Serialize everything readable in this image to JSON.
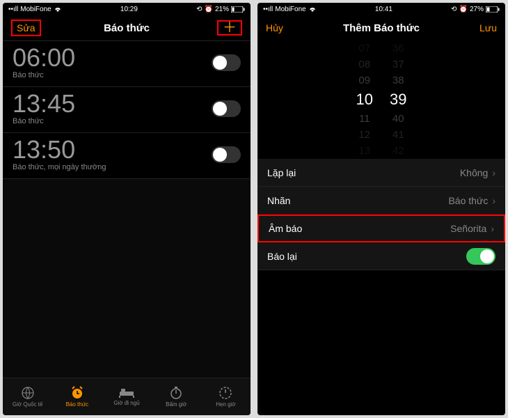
{
  "left": {
    "status": {
      "carrier": "MobiFone",
      "wifi": true,
      "time": "10:29",
      "alarm": true,
      "battery": "21%"
    },
    "nav": {
      "left": "Sửa",
      "title": "Báo thức",
      "right": "＋"
    },
    "alarms": [
      {
        "time": "06:00",
        "label": "Báo thức",
        "on": false
      },
      {
        "time": "13:45",
        "label": "Báo thức",
        "on": false
      },
      {
        "time": "13:50",
        "label": "Báo thức, mọi ngày thường",
        "on": false
      }
    ],
    "tabs": [
      {
        "label": "Giờ Quốc tế",
        "active": false
      },
      {
        "label": "Báo thức",
        "active": true
      },
      {
        "label": "Giờ đi ngủ",
        "active": false
      },
      {
        "label": "Bấm giờ",
        "active": false
      },
      {
        "label": "Hẹn giờ",
        "active": false
      }
    ]
  },
  "right": {
    "status": {
      "carrier": "MobiFone",
      "wifi": true,
      "time": "10:41",
      "alarm": true,
      "battery": "27%"
    },
    "nav": {
      "left": "Hủy",
      "title": "Thêm Báo thức",
      "right": "Lưu"
    },
    "picker": {
      "hours": [
        "07",
        "08",
        "09",
        "10",
        "11",
        "12",
        "13"
      ],
      "minutes": [
        "36",
        "37",
        "38",
        "39",
        "40",
        "41",
        "42"
      ],
      "sel_hour": "10",
      "sel_min": "39"
    },
    "rows": [
      {
        "key": "Lặp lại",
        "val": "Không",
        "type": "chevron"
      },
      {
        "key": "Nhãn",
        "val": "Báo thức",
        "type": "chevron"
      },
      {
        "key": "Âm báo",
        "val": "Señorita",
        "type": "chevron",
        "highlight": true
      },
      {
        "key": "Báo lại",
        "val": "",
        "type": "switch",
        "on": true
      }
    ]
  }
}
